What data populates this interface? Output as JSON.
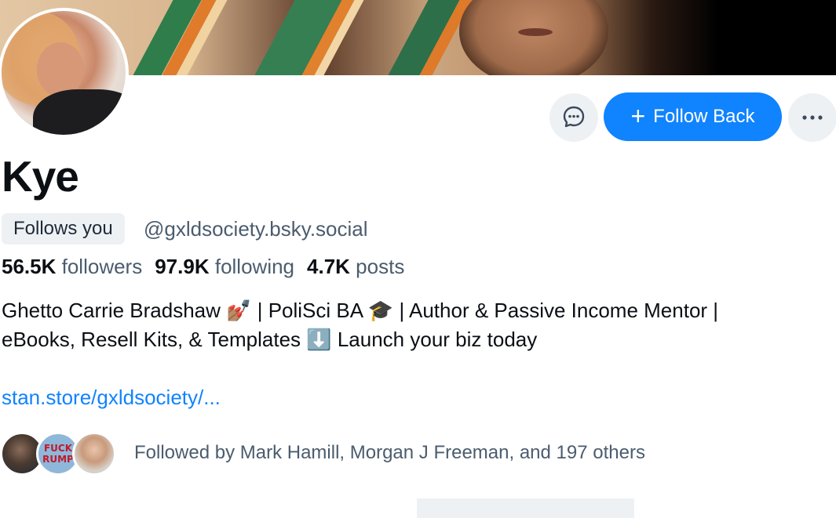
{
  "profile": {
    "display_name": "Kye",
    "follows_you_badge": "Follows you",
    "handle": "@gxldsociety.bsky.social",
    "stats": {
      "followers_count": "56.5K",
      "followers_label": "followers",
      "following_count": "97.9K",
      "following_label": "following",
      "posts_count": "4.7K",
      "posts_label": "posts"
    },
    "bio": {
      "line1": "Ghetto Carrie Bradshaw 💅🏽 | PoliSci BA 🎓 | Author & Passive Income Mentor |",
      "line2": "eBooks, Resell Kits, & Templates ⬇️ Launch your biz today"
    },
    "link": "stan.store/gxldsociety/..."
  },
  "actions": {
    "follow_back_label": "Follow Back",
    "message_icon": "message-bubble-icon",
    "more_icon": "ellipsis-icon"
  },
  "followed_by": {
    "text": "Followed by Mark Hamill, Morgan J Freeman, and 197 others",
    "avatar2_text_top": "FUCK",
    "avatar2_text_bottom": "RUMP"
  },
  "colors": {
    "accent": "#1083fe",
    "muted_text": "#4b5c6e",
    "button_bg": "#eef1f4"
  }
}
